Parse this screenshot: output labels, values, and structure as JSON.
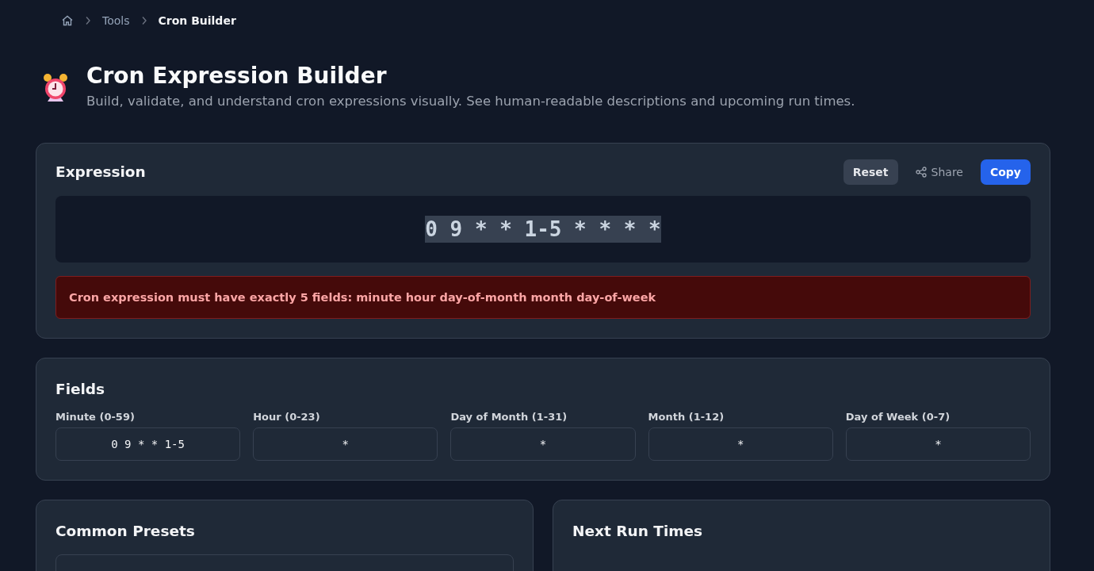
{
  "breadcrumb": {
    "items": [
      {
        "label": "Tools",
        "current": false
      },
      {
        "label": "Cron Builder",
        "current": true
      }
    ]
  },
  "header": {
    "title": "Cron Expression Builder",
    "subtitle": "Build, validate, and understand cron expressions visually. See human-readable descriptions and upcoming run times."
  },
  "expression_card": {
    "title": "Expression",
    "buttons": [
      {
        "kind": "secondary",
        "label": "Reset"
      },
      {
        "kind": "ghost",
        "label": "Share"
      },
      {
        "kind": "primary",
        "label": "Copy"
      }
    ],
    "expression": {
      "text": "0 9 * * 1-5 * * * *",
      "highlighted": true
    },
    "error": "Cron expression must have exactly 5 fields: minute hour day-of-month month day-of-week"
  },
  "fields_card": {
    "title": "Fields",
    "fields": [
      {
        "label": "Minute (0-59)",
        "value": "0 9 * * 1-5"
      },
      {
        "label": "Hour (0-23)",
        "value": "*"
      },
      {
        "label": "Day of Month (1-31)",
        "value": "*"
      },
      {
        "label": "Month (1-12)",
        "value": "*"
      },
      {
        "label": "Day of Week (0-7)",
        "value": "*"
      }
    ]
  },
  "presets_card": {
    "title": "Common Presets"
  },
  "next_runs_card": {
    "title": "Next Run Times"
  }
}
